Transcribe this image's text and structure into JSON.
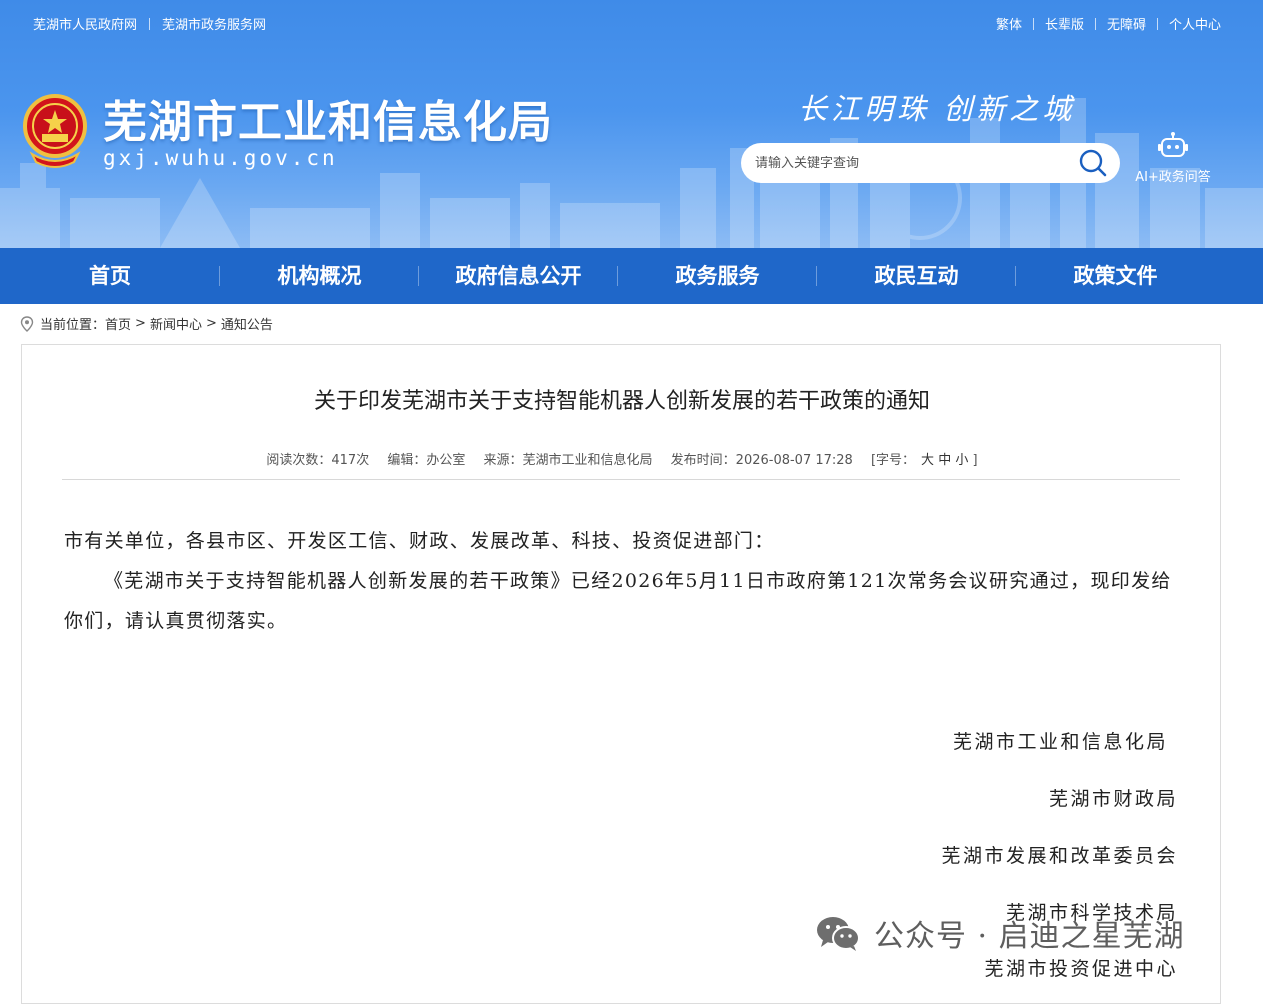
{
  "header": {
    "top_links": [
      "芜湖市人民政府网",
      "芜湖市政务服务网"
    ],
    "top_right": [
      "繁体",
      "长辈版",
      "无障碍",
      "个人中心"
    ],
    "site_title": "芜湖市工业和信息化局",
    "site_domain": "gxj.wuhu.gov.cn",
    "slogan": "长江明珠 创新之城",
    "search_placeholder": "请输入关键字查询",
    "ai_label": "AI+政务问答"
  },
  "nav": {
    "items": [
      "首页",
      "机构概况",
      "政府信息公开",
      "政务服务",
      "政民互动",
      "政策文件"
    ]
  },
  "breadcrumb": {
    "prefix": "当前位置：",
    "items": [
      "首页",
      "新闻中心",
      "通知公告"
    ]
  },
  "article": {
    "title": "关于印发芜湖市关于支持智能机器人创新发展的若干政策的通知",
    "meta": {
      "views": "阅读次数：417次",
      "editor": "编辑：办公室",
      "source": "来源：芜湖市工业和信息化局",
      "published": "发布时间：2026-08-07 17:28",
      "font_label": "[字号：",
      "font_sizes": [
        "大",
        "中",
        "小"
      ],
      "font_close": "]"
    },
    "paragraphs": [
      "市有关单位，各县市区、开发区工信、财政、发展改革、科技、投资促进部门：",
      "《芜湖市关于支持智能机器人创新发展的若干政策》已经2026年5月11日市政府第121次常务会议研究通过，现印发给你们，请认真贯彻落实。"
    ],
    "signatures": [
      "芜湖市工业和信息化局",
      "芜湖市财政局",
      "芜湖市发展和改革委员会",
      "芜湖市科学技术局",
      "芜湖市投资促进中心"
    ]
  },
  "watermark": "公众号 · 启迪之星芜湖",
  "icons": {
    "emblem": "national-emblem-icon",
    "search": "search-icon",
    "ai": "robot-icon",
    "location": "location-pin-icon",
    "wechat": "wechat-icon"
  },
  "colors": {
    "header_blue": "#4b95ee",
    "nav_blue": "#1f67c9"
  }
}
